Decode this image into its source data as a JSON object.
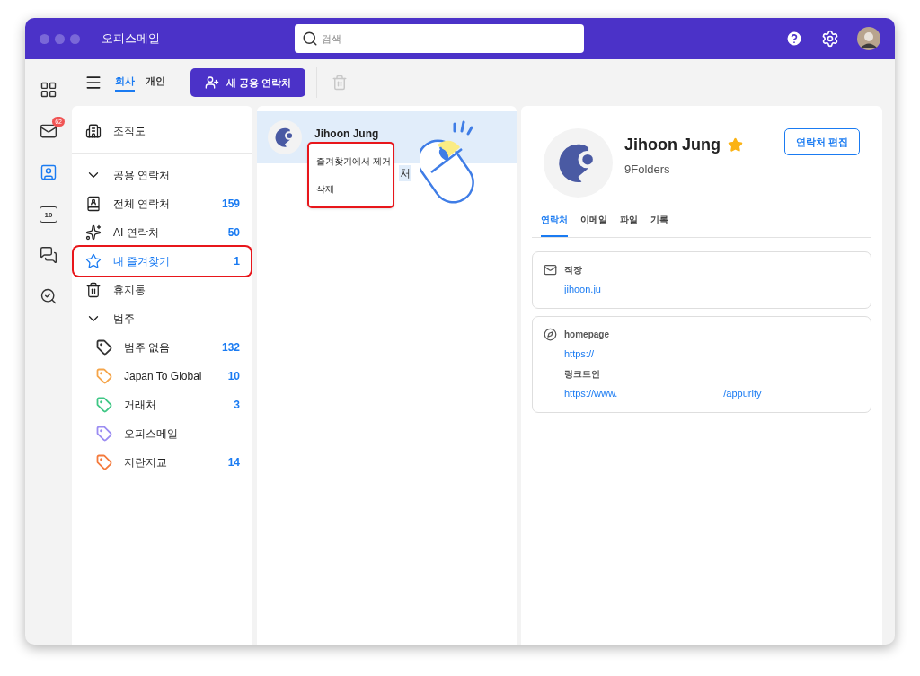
{
  "window": {
    "title": "오피스메일"
  },
  "search": {
    "placeholder": "검색"
  },
  "rail": [
    {
      "kind": "apps",
      "selected": false
    },
    {
      "kind": "mail",
      "selected": false,
      "badge": "62"
    },
    {
      "kind": "contacts",
      "selected": true
    },
    {
      "kind": "calendar",
      "selected": false,
      "day": "10"
    },
    {
      "kind": "chat",
      "selected": false
    },
    {
      "kind": "search",
      "selected": false
    }
  ],
  "scope_tabs": [
    {
      "label": "회사",
      "selected": true
    },
    {
      "label": "개인",
      "selected": false
    }
  ],
  "new_button": "새 공용 연락처",
  "sidebar": {
    "items": [
      {
        "kind": "org",
        "label": "조직도",
        "selected": false
      },
      {
        "kind": "group",
        "label": "공용 연락처",
        "expanded": true,
        "selected": false
      },
      {
        "kind": "all",
        "label": "전체 연락처",
        "count": "159",
        "selected": false
      },
      {
        "kind": "ai",
        "label": "AI 연락처",
        "count": "50",
        "selected": false
      },
      {
        "kind": "favorites",
        "label": "내 즐겨찾기",
        "count": "1",
        "selected": true
      },
      {
        "kind": "trash",
        "label": "휴지통",
        "selected": false
      },
      {
        "kind": "group",
        "label": "범주",
        "expanded": true,
        "selected": false
      },
      {
        "kind": "category",
        "label": "범주 없음",
        "count": "132",
        "color": "#333333",
        "selected": false
      },
      {
        "kind": "category",
        "label": "Japan To Global",
        "count": "10",
        "color": "#f5a54a",
        "selected": false
      },
      {
        "kind": "category",
        "label": "거래처",
        "count": "3",
        "color": "#3fc785",
        "selected": false
      },
      {
        "kind": "category",
        "label": "오피스메일",
        "color": "#9b8cf2",
        "selected": false
      },
      {
        "kind": "category",
        "label": "지란지교",
        "count": "14",
        "color": "#f47a3c",
        "selected": false
      }
    ]
  },
  "contact_list": [
    {
      "name": "Jihoon Jung",
      "subtitle": "처",
      "selected": true
    }
  ],
  "context_menu": [
    "즐겨찾기에서 제거",
    "삭제"
  ],
  "detail": {
    "name": "Jihoon Jung",
    "favorite": true,
    "company": "9Folders",
    "edit_button": "연락처 편집",
    "tabs": [
      {
        "label": "연락처",
        "selected": true
      },
      {
        "label": "이메일",
        "selected": false
      },
      {
        "label": "파일",
        "selected": false
      },
      {
        "label": "기록",
        "selected": false
      }
    ],
    "cards": [
      {
        "kind": "email",
        "fields": [
          {
            "label": "직장",
            "value": [
              "jihoon.ju"
            ]
          }
        ]
      },
      {
        "kind": "web",
        "fields": [
          {
            "label": "homepage",
            "value": [
              "https://"
            ]
          },
          {
            "label": "링크드인",
            "value": [
              "https://www.",
              "/appurity"
            ]
          }
        ]
      }
    ]
  }
}
